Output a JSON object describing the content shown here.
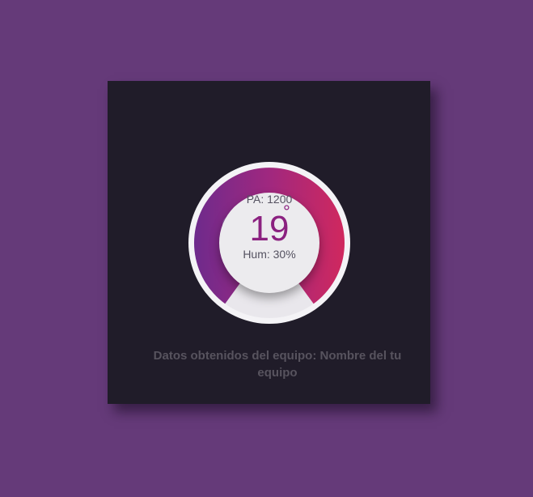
{
  "thermostat": {
    "pressure_text": "PA: 1200",
    "temperature": "19",
    "degree_symbol": "°",
    "humidity_text": "Hum: 30%",
    "colors": {
      "background": "#653a79",
      "card": "#201c29",
      "arc_start": "#6e2a8c",
      "arc_end": "#d0285e",
      "temperature": "#8b2180"
    }
  },
  "caption": {
    "text": "Datos obtenidos del equipo: Nombre del tu equipo"
  }
}
